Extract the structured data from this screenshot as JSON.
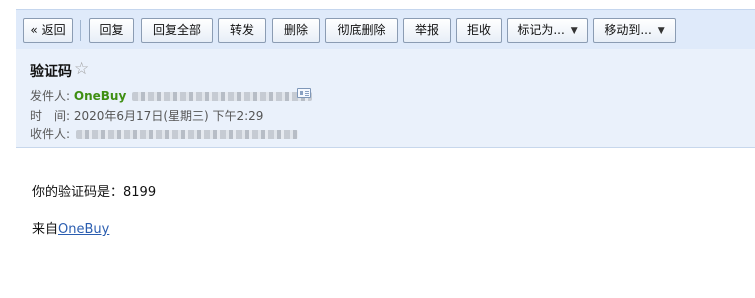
{
  "toolbar": {
    "back": "« 返回",
    "reply": "回复",
    "reply_all": "回复全部",
    "forward": "转发",
    "delete": "删除",
    "delete_permanent": "彻底删除",
    "report": "举报",
    "reject": "拒收",
    "mark_as": "标记为...",
    "move_to": "移动到..."
  },
  "header": {
    "subject": "验证码",
    "star_glyph": "☆",
    "from_label": "发件人:",
    "from_name": "OneBuy",
    "time_label": "时　间:",
    "time_value": "2020年6月17日(星期三) 下午2:29",
    "to_label": "收件人:"
  },
  "body": {
    "code_line": "你的验证码是：8199",
    "from_prefix": "来自",
    "from_link": "OneBuy"
  },
  "icons": {
    "dropdown": "chevron-down-icon",
    "contact_card": "contact-card-icon"
  }
}
